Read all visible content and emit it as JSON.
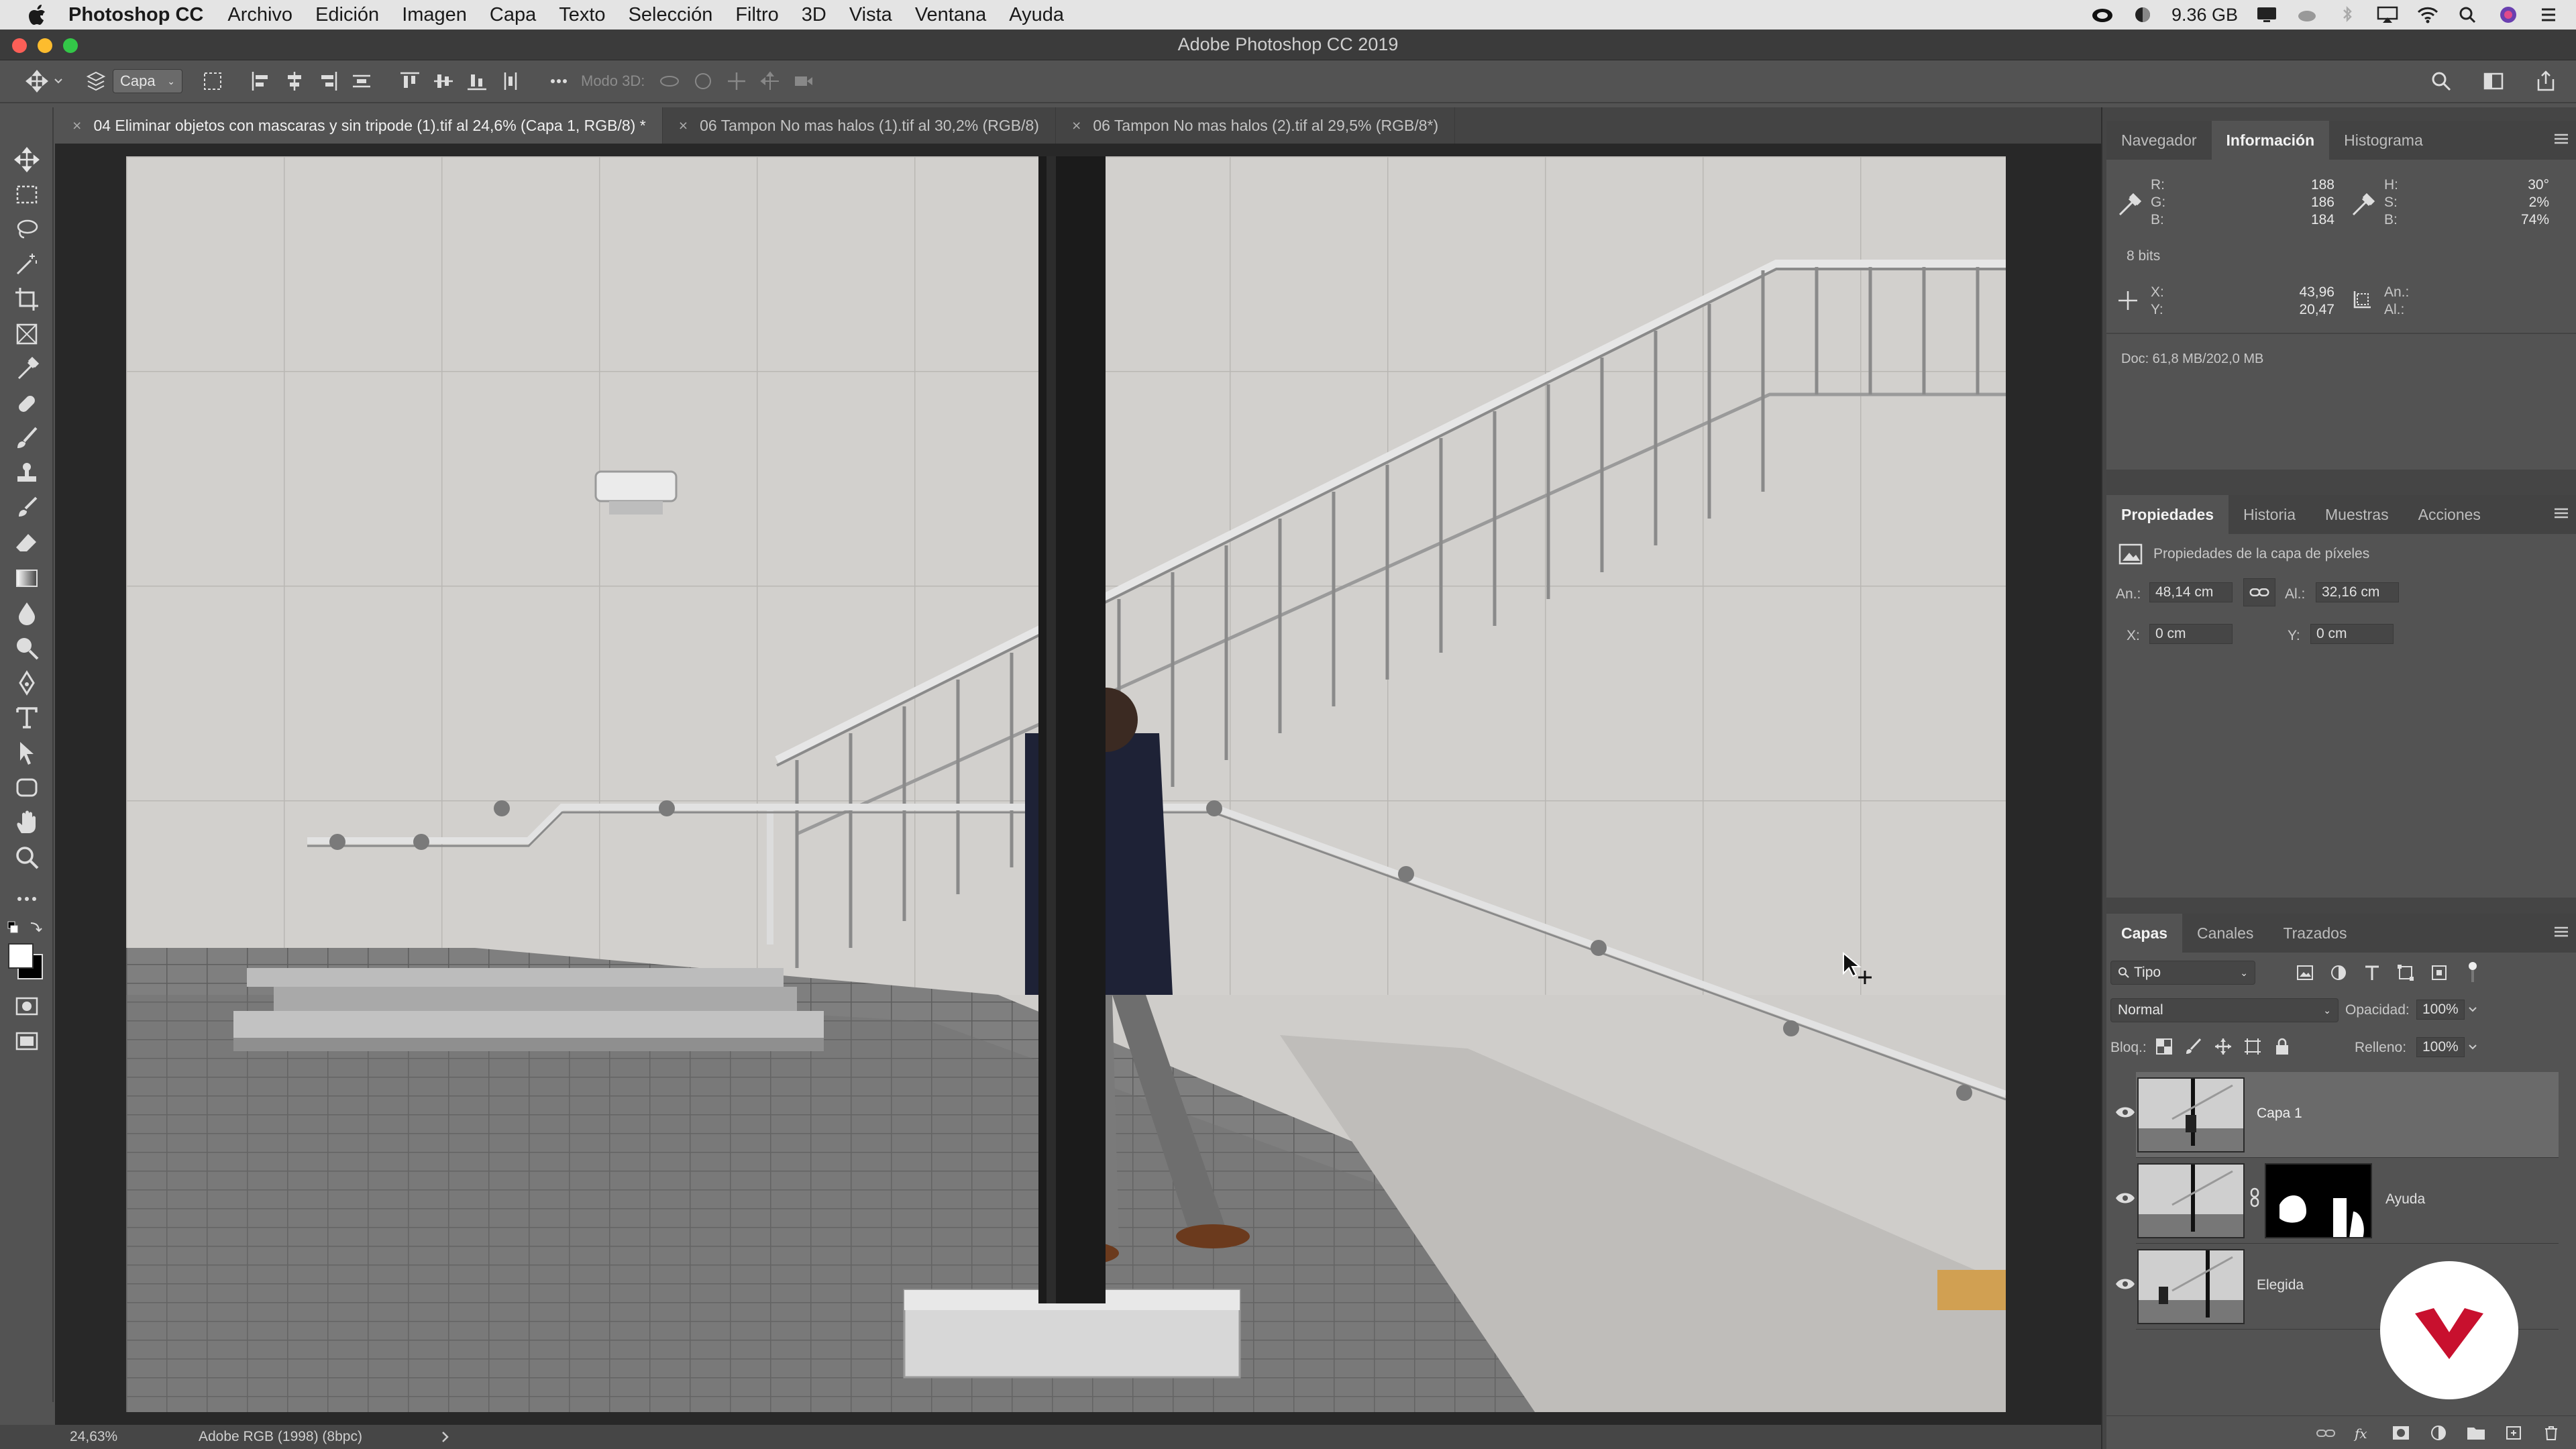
{
  "menubar": {
    "app_name": "Photoshop CC",
    "items": [
      "Archivo",
      "Edición",
      "Imagen",
      "Capa",
      "Texto",
      "Selección",
      "Filtro",
      "3D",
      "Vista",
      "Ventana",
      "Ayuda"
    ],
    "memory": "9.36 GB"
  },
  "window": {
    "title": "Adobe Photoshop CC 2019"
  },
  "options": {
    "layer_select": "Capa",
    "mode3d_label": "Modo 3D:"
  },
  "tabs": [
    {
      "label": "04 Eliminar objetos con mascaras y sin tripode (1).tif al 24,6% (Capa 1, RGB/8) *",
      "active": true
    },
    {
      "label": "06 Tampon No mas halos (1).tif al 30,2% (RGB/8)",
      "active": false
    },
    {
      "label": "06 Tampon No mas halos (2).tif al 29,5% (RGB/8*)",
      "active": false
    }
  ],
  "status": {
    "zoom": "24,63%",
    "profile": "Adobe RGB (1998) (8bpc)"
  },
  "info_panel": {
    "tabs": [
      "Navegador",
      "Información",
      "Histograma"
    ],
    "active_tab": "Información",
    "rgb": {
      "R": "188",
      "G": "186",
      "B": "184"
    },
    "hsb": {
      "H": "30°",
      "S": "2%",
      "B": "74%"
    },
    "bits": "8 bits",
    "xy": {
      "X": "43,96",
      "Y": "20,47"
    },
    "size_labels": {
      "An": "An.:",
      "Al": "Al.:"
    },
    "doc": "Doc: 61,8 MB/202,0 MB"
  },
  "properties_panel": {
    "tabs": [
      "Propiedades",
      "Historia",
      "Muestras",
      "Acciones"
    ],
    "active_tab": "Propiedades",
    "heading": "Propiedades de la capa de píxeles",
    "width_label": "An.:",
    "width": "48,14 cm",
    "height_label": "Al.:",
    "height": "32,16 cm",
    "x_label": "X:",
    "x": "0 cm",
    "y_label": "Y:",
    "y": "0 cm"
  },
  "layers_panel": {
    "tabs": [
      "Capas",
      "Canales",
      "Trazados"
    ],
    "active_tab": "Capas",
    "filter": "Tipo",
    "blend_mode": "Normal",
    "opacity_label": "Opacidad:",
    "opacity": "100%",
    "lock_label": "Bloq.:",
    "fill_label": "Relleno:",
    "fill": "100%",
    "layers": [
      {
        "name": "Capa 1",
        "selected": true,
        "mask": false
      },
      {
        "name": "Ayuda",
        "selected": false,
        "mask": true
      },
      {
        "name": "Elegida",
        "selected": false,
        "mask": false
      }
    ]
  },
  "colors": {
    "panel_bg": "#535353",
    "canvas_bg": "#282828",
    "brand_red": "#c8102e"
  }
}
